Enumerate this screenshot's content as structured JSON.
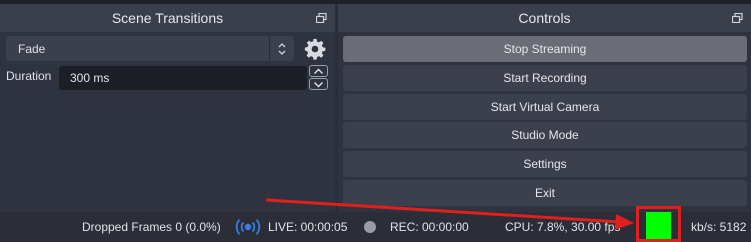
{
  "scene_transitions": {
    "title": "Scene Transitions",
    "transition_value": "Fade",
    "duration_label": "Duration",
    "duration_value": "300 ms"
  },
  "controls": {
    "title": "Controls",
    "buttons": [
      {
        "label": "Stop Streaming"
      },
      {
        "label": "Start Recording"
      },
      {
        "label": "Start Virtual Camera"
      },
      {
        "label": "Studio Mode"
      },
      {
        "label": "Settings"
      },
      {
        "label": "Exit"
      }
    ]
  },
  "status": {
    "dropped_frames": "Dropped Frames 0 (0.0%)",
    "live": "LIVE: 00:00:05",
    "rec": "REC: 00:00:00",
    "cpu": "CPU: 7.8%, 30.00 fps",
    "bitrate": "kb/s: 5182",
    "health_color": "#00ff00"
  },
  "colors": {
    "annotation_red": "#e0201c"
  },
  "icons": {
    "undock": "undock-icon",
    "gear": "gear-icon",
    "live": "broadcast-icon",
    "rec": "record-dot-icon"
  }
}
